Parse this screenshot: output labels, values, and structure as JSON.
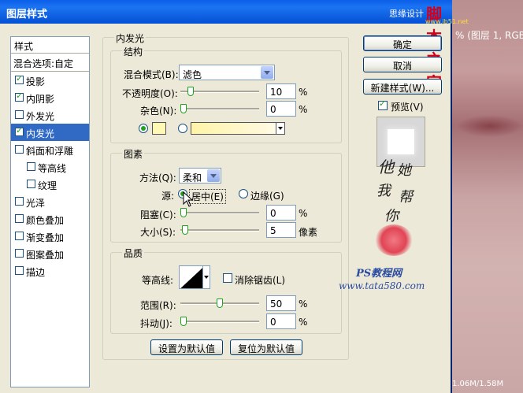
{
  "dialog": {
    "title": "图层样式",
    "site_text": "思缘设计",
    "watermark_logo": "脚本之家",
    "watermark_logo_sub": "www.jb51.net"
  },
  "background": {
    "doc_info": "% (图层 1, RGB/",
    "status": "1.06M/1.58M"
  },
  "style_list": {
    "header": "样式",
    "blend_options": "混合选项:自定",
    "items": [
      {
        "label": "投影",
        "checked": true,
        "indent": false,
        "selected": false
      },
      {
        "label": "内阴影",
        "checked": true,
        "indent": false,
        "selected": false
      },
      {
        "label": "外发光",
        "checked": false,
        "indent": false,
        "selected": false
      },
      {
        "label": "内发光",
        "checked": true,
        "indent": false,
        "selected": true
      },
      {
        "label": "斜面和浮雕",
        "checked": false,
        "indent": false,
        "selected": false
      },
      {
        "label": "等高线",
        "checked": false,
        "indent": true,
        "selected": false
      },
      {
        "label": "纹理",
        "checked": false,
        "indent": true,
        "selected": false
      },
      {
        "label": "光泽",
        "checked": false,
        "indent": false,
        "selected": false
      },
      {
        "label": "颜色叠加",
        "checked": false,
        "indent": false,
        "selected": false
      },
      {
        "label": "渐变叠加",
        "checked": false,
        "indent": false,
        "selected": false
      },
      {
        "label": "图案叠加",
        "checked": false,
        "indent": false,
        "selected": false
      },
      {
        "label": "描边",
        "checked": false,
        "indent": false,
        "selected": false
      }
    ]
  },
  "inner_glow": {
    "title": "内发光",
    "structure": {
      "title": "结构",
      "blend_mode_label": "混合模式(B):",
      "blend_mode_value": "滤色",
      "opacity_label": "不透明度(O):",
      "opacity_value": "10",
      "noise_label": "杂色(N):",
      "noise_value": "0",
      "percent": "%"
    },
    "elements": {
      "title": "图素",
      "method_label": "方法(Q):",
      "method_value": "柔和",
      "source_label": "源:",
      "source_center": "居中(E)",
      "source_edge": "边缘(G)",
      "choke_label": "阻塞(C):",
      "choke_value": "0",
      "size_label": "大小(S):",
      "size_value": "5",
      "size_unit": "像素",
      "percent": "%"
    },
    "quality": {
      "title": "品质",
      "contour_label": "等高线:",
      "antialias_label": "消除锯齿(L)",
      "range_label": "范围(R):",
      "range_value": "50",
      "jitter_label": "抖动(J):",
      "jitter_value": "0",
      "percent": "%"
    },
    "buttons": {
      "make_default": "设置为默认值",
      "reset_default": "复位为默认值"
    }
  },
  "right_buttons": {
    "ok": "确定",
    "cancel": "取消",
    "new_style": "新建样式(W)...",
    "preview": "预览(V)"
  },
  "watermarks": {
    "handwriting": [
      "他",
      "她",
      "我",
      "帮",
      "你"
    ],
    "ps_tutorial": "PS教程网",
    "tata_url": "www.tata580.com"
  },
  "levels": {
    "opacity": 0.1,
    "noise": 0.0,
    "choke": 0.0,
    "size": 0.02,
    "range": 0.5,
    "jitter": 0.0
  }
}
